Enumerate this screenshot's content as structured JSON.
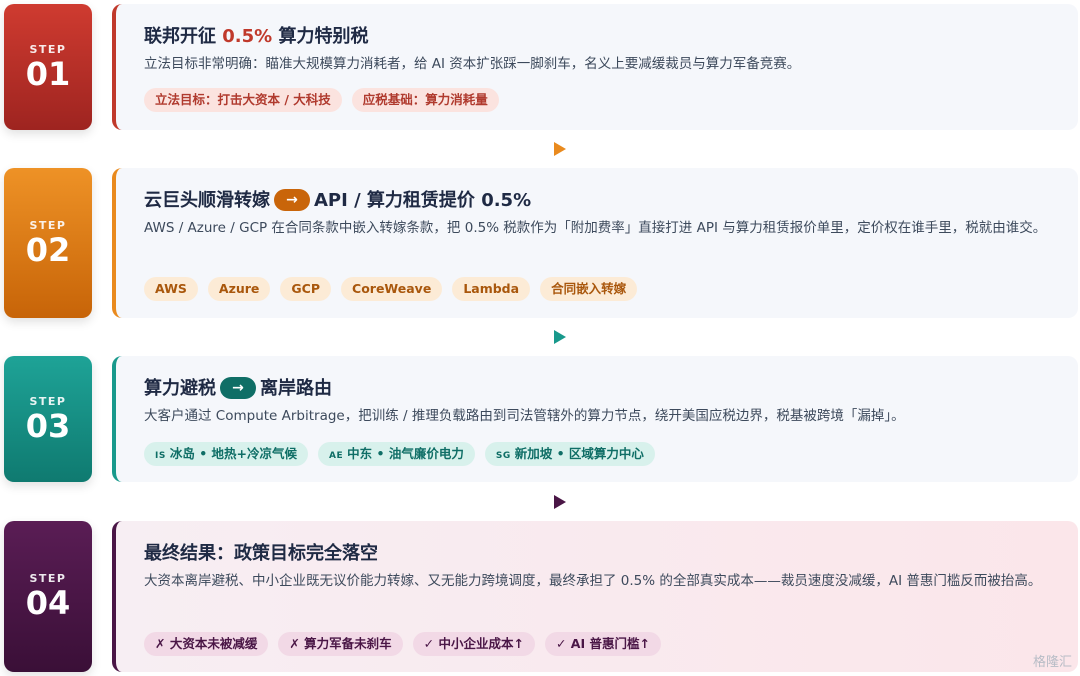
{
  "steps": [
    {
      "label": "STEP",
      "number": "01",
      "title_pre": "联邦开征 ",
      "title_highlight": "0.5%",
      "title_post": " 算力特别税",
      "description": "立法目标非常明确：瞄准大规模算力消耗者，给 AI 资本扩张踩一脚刹车，名义上要减缓裁员与算力军备竞赛。",
      "tags": [
        {
          "text": "立法目标：打击大资本 / 大科技"
        },
        {
          "text": "应税基础：算力消耗量"
        }
      ],
      "color": "#b5312b"
    },
    {
      "label": "STEP",
      "number": "02",
      "title_pre": "云巨头顺滑转嫁",
      "arrow": "→",
      "title_post": "API / 算力租赁提价 0.5%",
      "description": "AWS / Azure / GCP 在合同条款中嵌入转嫁条款，把 0.5% 税款作为「附加费率」直接打进 API 与算力租赁报价单里，定价权在谁手里，税就由谁交。",
      "tags": [
        {
          "text": "AWS"
        },
        {
          "text": "Azure"
        },
        {
          "text": "GCP"
        },
        {
          "text": "CoreWeave"
        },
        {
          "text": "Lambda"
        },
        {
          "text": "合同嵌入转嫁"
        }
      ],
      "color": "#df7b12"
    },
    {
      "label": "STEP",
      "number": "03",
      "title_pre": "算力避税",
      "arrow": "→",
      "title_post": "离岸路由",
      "description": "大客户通过 Compute Arbitrage，把训练 / 推理负载路由到司法管辖外的算力节点，绕开美国应税边界，税基被跨境「漏掉」。",
      "tags": [
        {
          "sub": "IS",
          "text": "冰岛 • 地热+冷凉气候"
        },
        {
          "sub": "AE",
          "text": "中东 • 油气廉价电力"
        },
        {
          "sub": "SG",
          "text": "新加坡 • 区域算力中心"
        }
      ],
      "color": "#158f84"
    },
    {
      "label": "STEP",
      "number": "04",
      "title_pre": "最终结果：政策目标完全落空",
      "description": "大资本离岸避税、中小企业既无议价能力转嫁、又无能力跨境调度，最终承担了 0.5% 的全部真实成本——裁员速度没减缓，AI 普惠门槛反而被抬高。",
      "tags": [
        {
          "text": "✗ 大资本未被减缓"
        },
        {
          "text": "✗ 算力军备未刹车"
        },
        {
          "text": "✓ 中小企业成本↑"
        },
        {
          "text": "✓ AI 普惠门槛↑"
        }
      ],
      "color": "#4a1646"
    }
  ],
  "watermark": "格隆汇"
}
